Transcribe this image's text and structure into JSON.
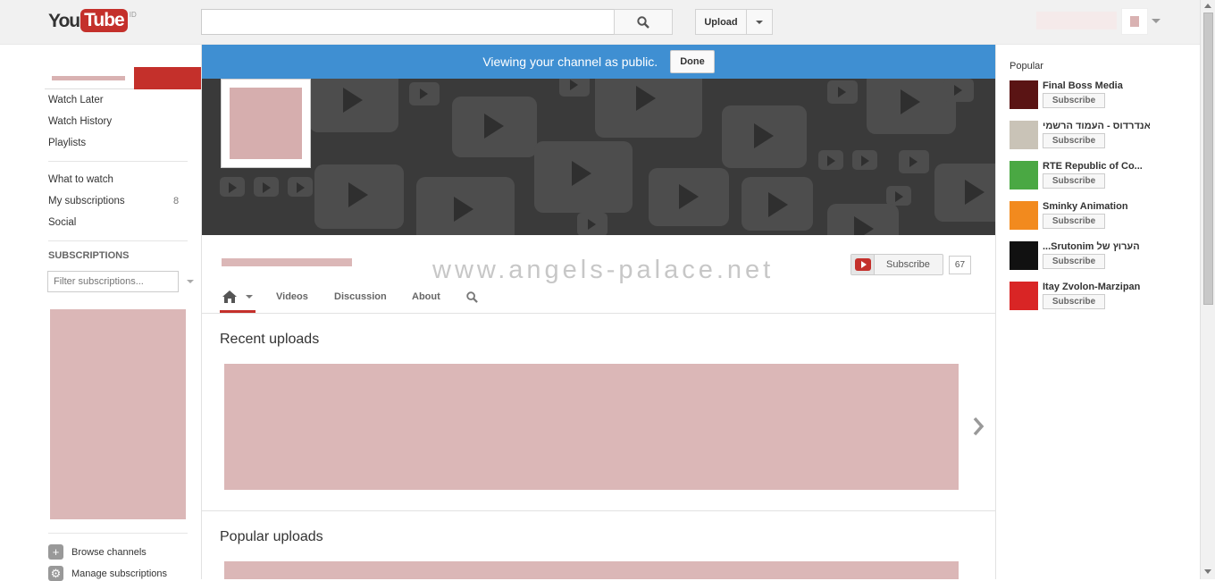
{
  "masthead": {
    "logo_you": "You",
    "logo_tube": "Tube",
    "logo_region": "ID",
    "search_placeholder": "",
    "upload_label": "Upload"
  },
  "guide": {
    "items_top": [
      "Watch Later",
      "Watch History",
      "Playlists"
    ],
    "items_mid": [
      "What to watch",
      "My subscriptions",
      "Social"
    ],
    "subscriptions_count": "8",
    "subscriptions_heading": "SUBSCRIPTIONS",
    "filter_placeholder": "Filter subscriptions...",
    "footer": [
      "Browse channels",
      "Manage subscriptions"
    ]
  },
  "main": {
    "public_notice": "Viewing your channel as public.",
    "done_label": "Done",
    "subscribe_label": "Subscribe",
    "subscriber_count": "67",
    "tabs": [
      "Videos",
      "Discussion",
      "About"
    ],
    "section_recent": "Recent uploads",
    "section_popular": "Popular uploads",
    "watermark": "www.angels-palace.net"
  },
  "right": {
    "title": "Popular",
    "subscribe_label": "Subscribe",
    "channels": [
      {
        "name": "Final Boss Media",
        "thumb_color": "#5a1414"
      },
      {
        "name": "אנדרדוס - העמוד הרשמי",
        "thumb_color": "#c9c3b7"
      },
      {
        "name": "RTE Republic of Co...",
        "thumb_color": "#4aa843"
      },
      {
        "name": "Sminky Animation",
        "thumb_color": "#f28a1e"
      },
      {
        "name": "...Srutonim הערוץ של",
        "thumb_color": "#111111"
      },
      {
        "name": "Itay Zvolon-Marzipan",
        "thumb_color": "#d92525"
      }
    ]
  },
  "colors": {
    "brand_red": "#c4302b",
    "notice_blue": "#3f8fd2",
    "redacted_pink": "#dbb7b7"
  }
}
